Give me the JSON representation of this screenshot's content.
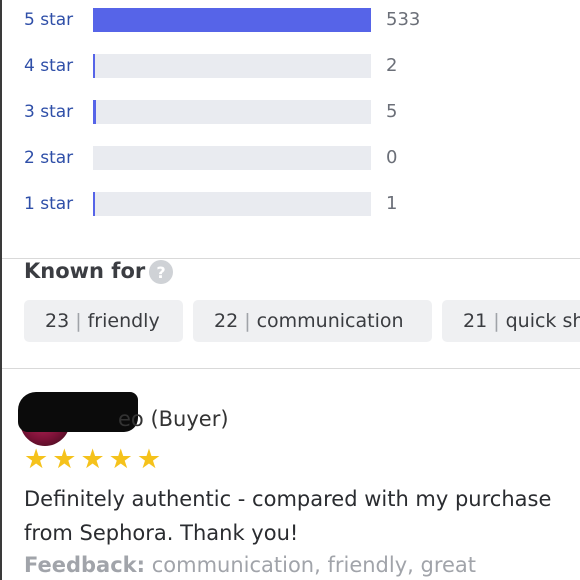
{
  "ratings": [
    {
      "label": "5 star",
      "count": "533",
      "fraction": 1.0
    },
    {
      "label": "4 star",
      "count": "2",
      "fraction": 0.004
    },
    {
      "label": "3 star",
      "count": "5",
      "fraction": 0.009
    },
    {
      "label": "2 star",
      "count": "0",
      "fraction": 0.0
    },
    {
      "label": "1 star",
      "count": "1",
      "fraction": 0.002
    }
  ],
  "known_for": {
    "title": "Known for",
    "help_icon": "?",
    "chips": [
      {
        "count": "23",
        "label": "friendly"
      },
      {
        "count": "22",
        "label": "communication"
      },
      {
        "count": "21",
        "label": "quick sh"
      }
    ]
  },
  "review": {
    "reviewer_suffix": "eo (Buyer)",
    "stars": 5,
    "text": "Definitely authentic - compared with my purchase from Sephora. Thank you!",
    "feedback_label": "Feedback:",
    "feedback_value": "communication, friendly, great"
  },
  "colors": {
    "bar_fill": "#5664e8",
    "bar_track": "#e9ebf0",
    "label_blue": "#2f4fa8",
    "star": "#f5c21b"
  }
}
